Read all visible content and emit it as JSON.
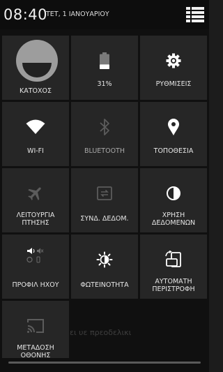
{
  "status_bar": {
    "time": "08:40",
    "date": "ΤΕΤ, 1 ΙΑΝΟΥΑΡΙΟΥ"
  },
  "background_notification": {
    "line1": "ει υε πρεοδελικι",
    "line2": ""
  },
  "battery_level": 0.31,
  "tiles": {
    "owner": "ΚΑΤΟΧΟΣ",
    "battery": "31%",
    "settings": "ΡΥΘΜΙΣΕΙΣ",
    "wifi": "WI-FI",
    "bluetooth": "BLUETOOTH",
    "location": "ΤΟΠΟΘΕΣΙΑ",
    "airplane_line1": "ΛΕΙΤΟΥΡΓΙΑ",
    "airplane_line2": "ΠΤΗΣΗΣ",
    "data_sync": "ΣΥΝΔ. ΔΕΔΟΜ.",
    "data_usage_line1": "ΧΡΗΣΗ",
    "data_usage_line2": "ΔΕΔΟΜΕΝΩΝ",
    "sound_profile": "ΠΡΟΦΙΛ ΗΧΟΥ",
    "brightness": "ΦΩΤΕΙΝΟΤΗΤΑ",
    "rotation_line1": "ΑΥΤΟΜΑΤΗ",
    "rotation_line2": "ΠΕΡΙΣΤΡΟΦΗ",
    "cast_line1": "ΜΕΤΑΔΟΣΗ",
    "cast_line2": "ΟΘΟΝΗΣ"
  },
  "icons": {
    "owner": "avatar-icon",
    "battery": "battery-icon",
    "settings": "gear-icon",
    "wifi": "wifi-icon",
    "bluetooth": "bluetooth-icon",
    "location": "location-pin-icon",
    "airplane": "airplane-icon",
    "data_sync": "sync-icon",
    "data_usage": "pie-chart-icon",
    "sound": "volume-icon",
    "brightness": "sun-icon",
    "rotation": "rotate-icon",
    "cast": "cast-icon",
    "switch_view": "list-icon"
  },
  "colors": {
    "tile_bg": "#262626",
    "active_icon": "#ffffff",
    "dim_icon": "#5c5c5c"
  }
}
